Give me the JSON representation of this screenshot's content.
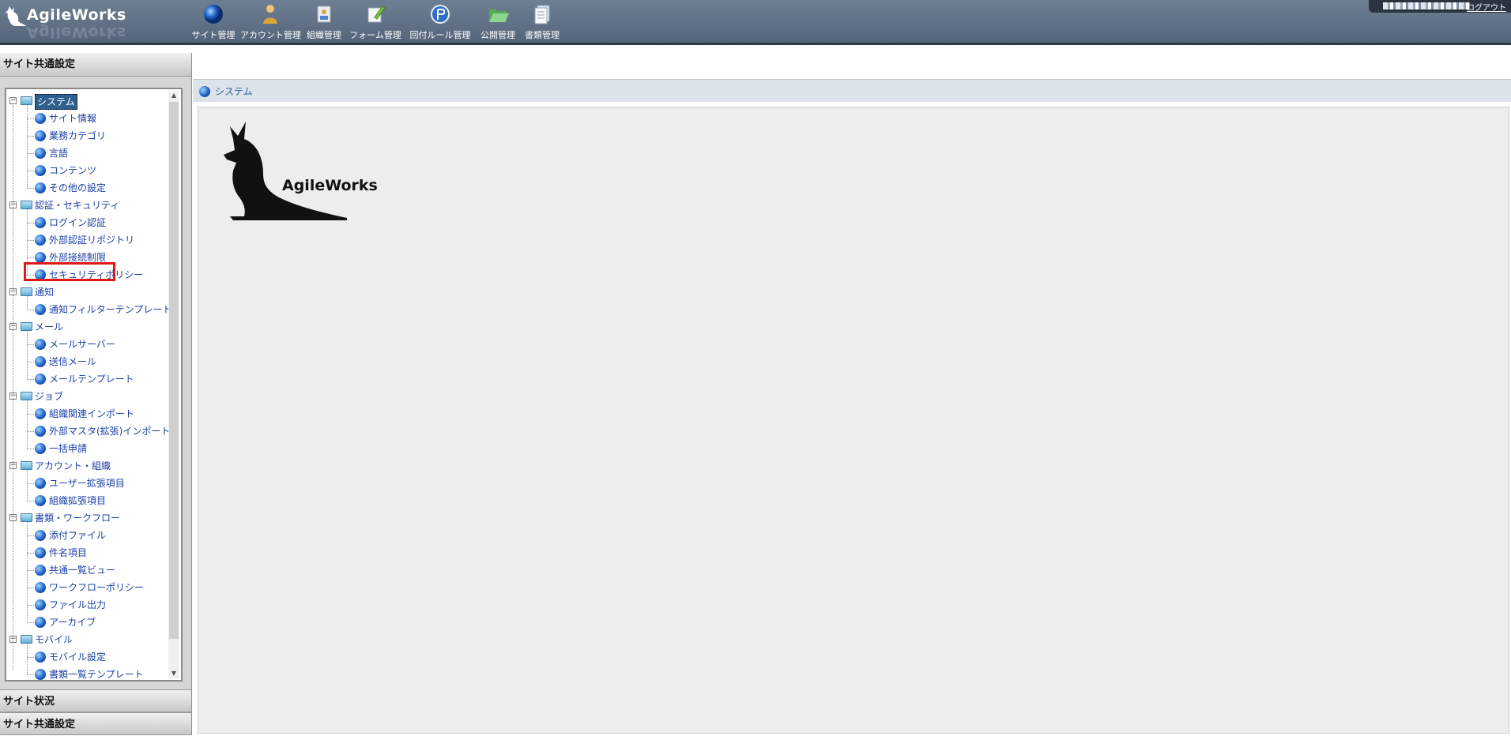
{
  "header": {
    "logo_text": "AgileWorks",
    "nav": [
      {
        "label": "サイト管理",
        "icon": "globe-icon"
      },
      {
        "label": "アカウント管理",
        "icon": "person-icon"
      },
      {
        "label": "組織管理",
        "icon": "organization-icon"
      },
      {
        "label": "フォーム管理",
        "icon": "form-edit-icon"
      },
      {
        "label": "回付ルール管理",
        "icon": "route-icon"
      },
      {
        "label": "公開管理",
        "icon": "folder-open-icon"
      },
      {
        "label": "書類管理",
        "icon": "document-icon"
      }
    ],
    "logout_label": "ログアウト"
  },
  "left_panel": {
    "title": "サイト共通設定",
    "tree": [
      {
        "label": "システム",
        "selected": true,
        "children": [
          "サイト情報",
          "業務カテゴリ",
          "言語",
          "コンテンツ",
          "その他の設定"
        ]
      },
      {
        "label": "認証・セキュリティ",
        "children": [
          "ログイン認証",
          "外部認証リポジトリ",
          "外部接続制限",
          "セキュリティポリシー"
        ]
      },
      {
        "label": "通知",
        "children": [
          "通知フィルターテンプレート"
        ]
      },
      {
        "label": "メール",
        "children": [
          "メールサーバー",
          "送信メール",
          "メールテンプレート"
        ]
      },
      {
        "label": "ジョブ",
        "children": [
          "組織関連インポート",
          "外部マスタ(拡張)インポート",
          "一括申請"
        ]
      },
      {
        "label": "アカウント・組織",
        "children": [
          "ユーザー拡張項目",
          "組織拡張項目"
        ]
      },
      {
        "label": "書類・ワークフロー",
        "children": [
          "添付ファイル",
          "件名項目",
          "共通一覧ビュー",
          "ワークフローポリシー",
          "ファイル出力",
          "アーカイブ"
        ]
      },
      {
        "label": "モバイル",
        "children": [
          "モバイル設定",
          "書類一覧テンプレート"
        ]
      }
    ],
    "bottom_sections": [
      "サイト状況",
      "サイト共通設定"
    ]
  },
  "main": {
    "breadcrumb": "システム",
    "brand_text": "AgileWorks"
  },
  "colors": {
    "header_bg": "#5d6e82",
    "link_blue": "#1a3fa6",
    "highlight_red": "#e01818",
    "content_bg": "#ededed"
  }
}
